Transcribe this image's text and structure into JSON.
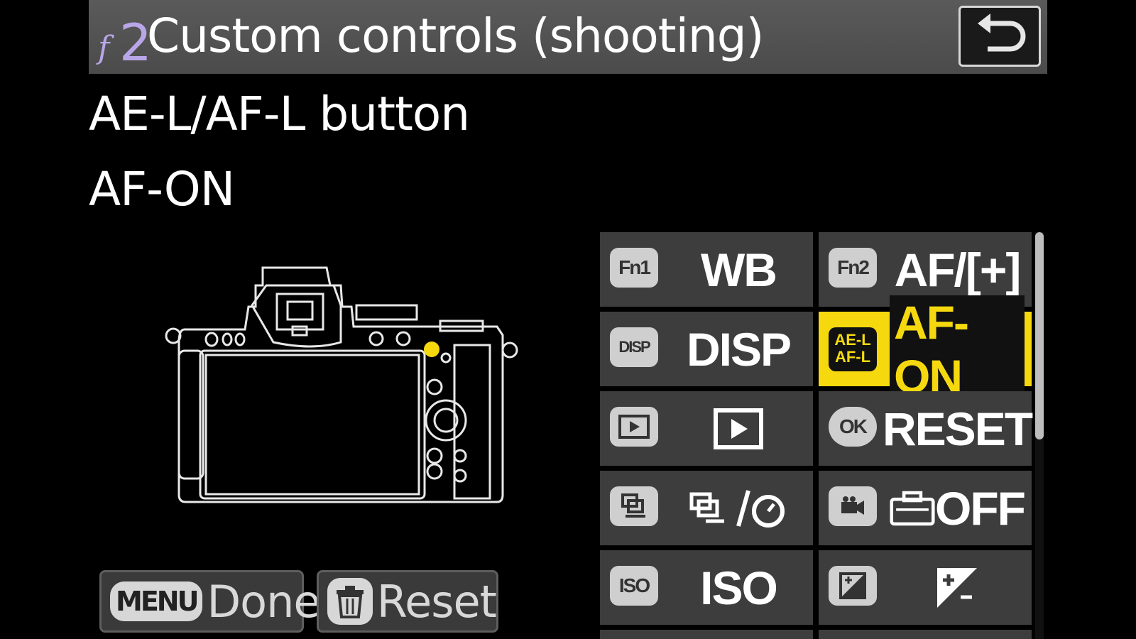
{
  "header": {
    "code_letter": "f",
    "code_number": "2",
    "title": "Custom controls (shooting)",
    "back_icon": "return-arrow-icon"
  },
  "setting": {
    "name": "AE-L/AF-L button",
    "value": "AF-ON"
  },
  "footer": {
    "done_key": "MENU",
    "done_label": "Done",
    "reset_icon": "trash-icon",
    "reset_label": "Reset"
  },
  "grid": {
    "cells": [
      {
        "key": "Fn1",
        "value": "WB",
        "selected": false
      },
      {
        "key": "Fn2",
        "value": "AF/[+]",
        "selected": false
      },
      {
        "key": "DISP",
        "value": "DISP",
        "selected": false
      },
      {
        "key": "AE-L AF-L",
        "value": "AF-ON",
        "selected": true
      },
      {
        "key": "playback-icon",
        "value": "playback-icon",
        "selected": false
      },
      {
        "key": "OK",
        "value": "RESET",
        "selected": false
      },
      {
        "key": "release-mode-icon",
        "value": "release-mode-selftimer-icon",
        "selected": false
      },
      {
        "key": "movie-record-icon",
        "value": "OFF",
        "selected": false
      },
      {
        "key": "ISO",
        "value": "ISO",
        "selected": false
      },
      {
        "key": "exposure-comp-icon",
        "value": "exposure-comp-icon",
        "selected": false
      }
    ]
  },
  "colors": {
    "header_bg": "#555555",
    "highlight": "#f5d90e",
    "cell_bg": "#3d3d3d",
    "code_color": "#b9a6e8"
  }
}
